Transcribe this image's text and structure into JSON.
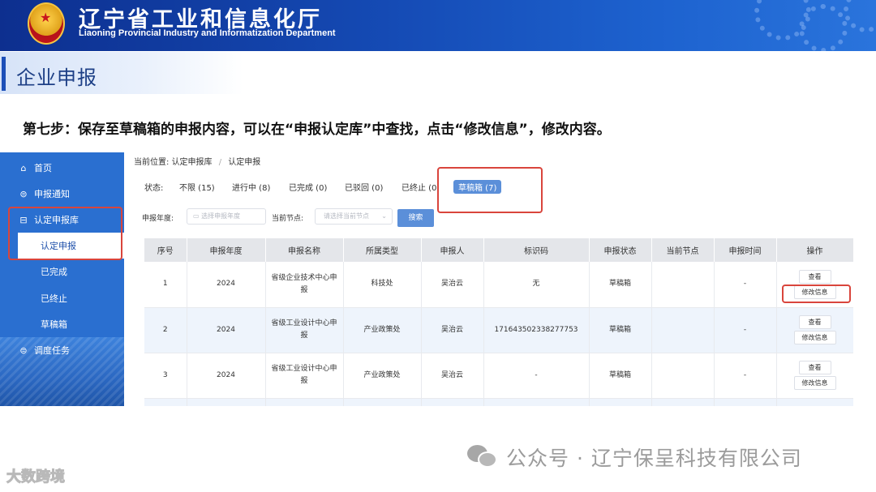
{
  "header": {
    "title": "辽宁省工业和信息化厅",
    "subtitle": "Liaoning Provincial Industry and Informatization Department"
  },
  "section": {
    "title": "企业申报"
  },
  "instruction": "第七步：保存至草稿箱的申报内容，可以在“申报认定库”中查找，点击“修改信息”，修改内容。",
  "sidebar": {
    "items": [
      {
        "icon": "home-icon",
        "label": "首页"
      },
      {
        "icon": "notice-icon",
        "label": "申报通知"
      },
      {
        "icon": "library-icon",
        "label": "认定申报库"
      },
      {
        "label": "认定申报",
        "active": true
      },
      {
        "label": "已完成"
      },
      {
        "label": "已终止"
      },
      {
        "label": "草稿箱"
      },
      {
        "icon": "task-icon",
        "label": "调度任务"
      }
    ]
  },
  "breadcrumb": {
    "prefix": "当前位置:",
    "items": [
      "认定申报库",
      "认定申报"
    ]
  },
  "status_filter": {
    "label": "状态:",
    "tabs": [
      {
        "label": "不限 (15)"
      },
      {
        "label": "进行中 (8)"
      },
      {
        "label": "已完成 (0)"
      },
      {
        "label": "已驳回 (0)"
      },
      {
        "label": "已终止 (0"
      },
      {
        "label": "草稿箱 (7)",
        "selected": true
      }
    ]
  },
  "filters": {
    "year_label": "申报年度:",
    "year_placeholder": "选择申报年度",
    "node_label": "当前节点:",
    "node_placeholder": "请选择当前节点",
    "search_label": "搜索"
  },
  "table": {
    "columns": [
      "序号",
      "申报年度",
      "申报名称",
      "所属类型",
      "申报人",
      "标识码",
      "申报状态",
      "当前节点",
      "申报时间",
      "操作"
    ],
    "rows": [
      {
        "index": "1",
        "year": "2024",
        "name": "省级企业技术中心申报",
        "type": "科技处",
        "applicant": "吴治云",
        "code": "无",
        "status": "草稿箱",
        "node": "",
        "time": "-",
        "view": "查看",
        "edit": "修改信息"
      },
      {
        "index": "2",
        "year": "2024",
        "name": "省级工业设计中心申报",
        "type": "产业政策处",
        "applicant": "吴治云",
        "code": "171643502338277753",
        "status": "草稿箱",
        "node": "",
        "time": "-",
        "view": "查看",
        "edit": "修改信息"
      },
      {
        "index": "3",
        "year": "2024",
        "name": "省级工业设计中心申报",
        "type": "产业政策处",
        "applicant": "吴治云",
        "code": "-",
        "status": "草稿箱",
        "node": "",
        "time": "-",
        "view": "查看",
        "edit": "修改信息"
      }
    ]
  },
  "watermark": {
    "right": "公众号 · 辽宁保呈科技有限公司",
    "left": "大数跨境"
  },
  "colors": {
    "banner": "#154bb5",
    "sidebar": "#2a6fd0",
    "accent": "#5b8fd9",
    "highlight": "#d9453c"
  }
}
